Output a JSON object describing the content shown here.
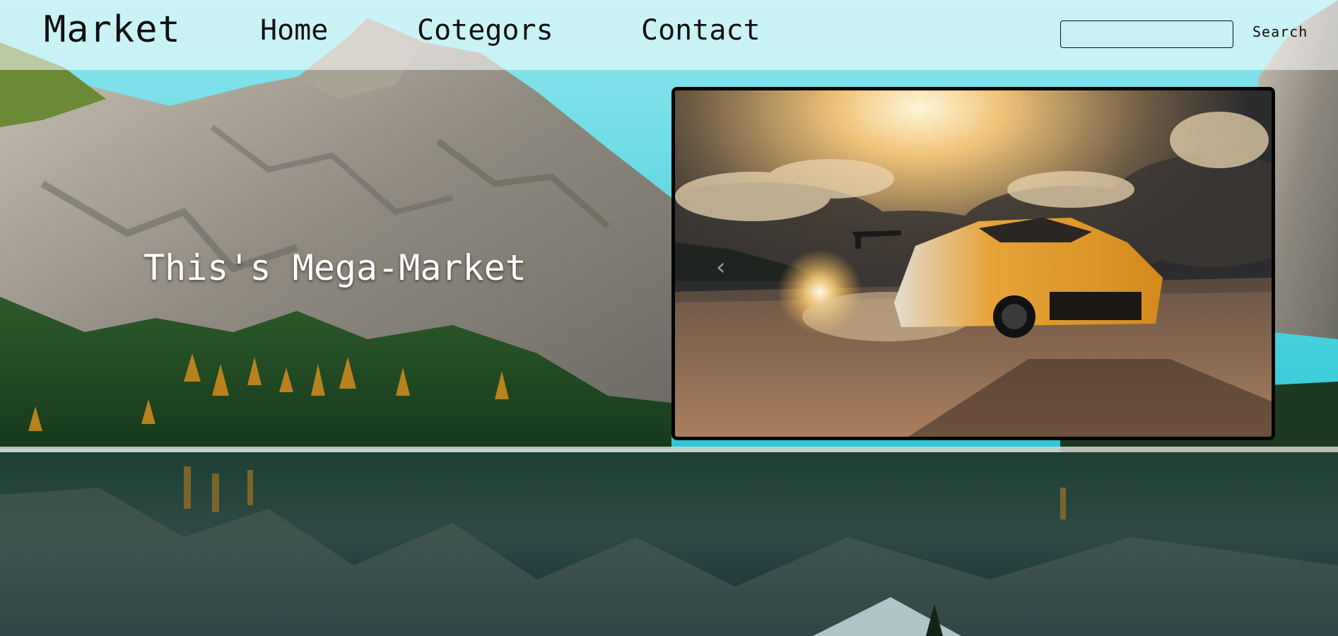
{
  "header": {
    "logo": "Market",
    "nav": [
      {
        "label": "Home"
      },
      {
        "label": "Cotegors"
      },
      {
        "label": "Contact"
      }
    ],
    "search": {
      "placeholder": "",
      "value": "",
      "button_label": "Search"
    }
  },
  "hero": {
    "title": "This's Mega-Market",
    "slide": {
      "prev_icon": "chevron-left-icon",
      "prev_glyph": "‹"
    }
  }
}
